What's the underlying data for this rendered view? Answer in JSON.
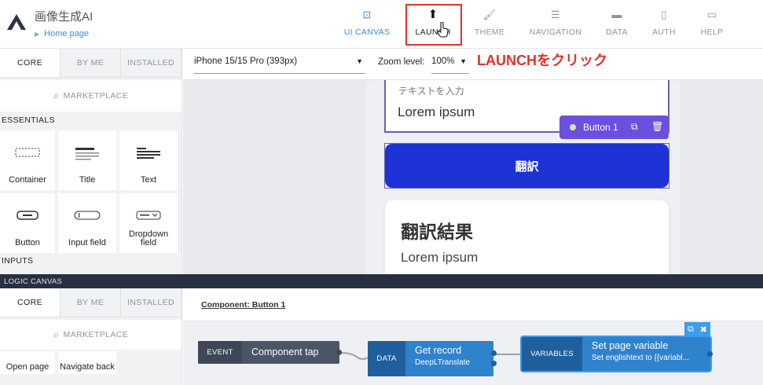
{
  "app": {
    "title": "画像生成AI",
    "breadcrumb": "Home page"
  },
  "nav": {
    "items": [
      {
        "label": "UI CANVAS",
        "icon": "ui-canvas-icon",
        "active": true
      },
      {
        "label": "LAUNCH",
        "icon": "launch-icon"
      },
      {
        "label": "THEME",
        "icon": "theme-brush-icon"
      },
      {
        "label": "NAVIGATION",
        "icon": "navigation-list-icon"
      },
      {
        "label": "DATA",
        "icon": "folder-icon"
      },
      {
        "label": "AUTH",
        "icon": "auth-file-icon"
      },
      {
        "label": "HELP",
        "icon": "help-chat-icon"
      }
    ]
  },
  "annotation": {
    "text": "LAUNCHをクリック",
    "color": "#e0332b"
  },
  "ui_panel": {
    "tabs": [
      "CORE",
      "BY ME",
      "INSTALLED"
    ],
    "marketplace": "MARKETPLACE",
    "section": "ESSENTIALS",
    "components": [
      "Container",
      "Title",
      "Text",
      "Button",
      "Input field",
      "Dropdown field"
    ],
    "next_section": "INPUTS"
  },
  "canvas": {
    "device": "iPhone 15/15 Pro (393px)",
    "zoom_label": "Zoom level:",
    "zoom": "100%",
    "input_label": "テキストを入力",
    "input_value": "Lorem ipsum",
    "selected_badge": "Button 1",
    "button_text": "翻訳",
    "result_title": "翻訳結果",
    "result_text": "Lorem ipsum"
  },
  "logic": {
    "bar_title": "LOGIC CANVAS",
    "tabs": [
      "CORE",
      "BY ME",
      "INSTALLED"
    ],
    "marketplace": "MARKETPLACE",
    "items": [
      "Open page",
      "Navigate back"
    ],
    "component_label": "Component: Button 1",
    "nodes": [
      {
        "kind": "EVENT",
        "title": "Component tap",
        "sub": ""
      },
      {
        "kind": "DATA",
        "title": "Get record",
        "sub": "DeepLTranslate"
      },
      {
        "kind": "VARIABLES",
        "title": "Set page variable",
        "sub": "Set englishtext to {{variabl..."
      }
    ]
  },
  "colors": {
    "accent": "#3a8dde",
    "primary_button": "#1e33d6",
    "selection": "#6d4fe0",
    "logic_bar": "#263041"
  }
}
